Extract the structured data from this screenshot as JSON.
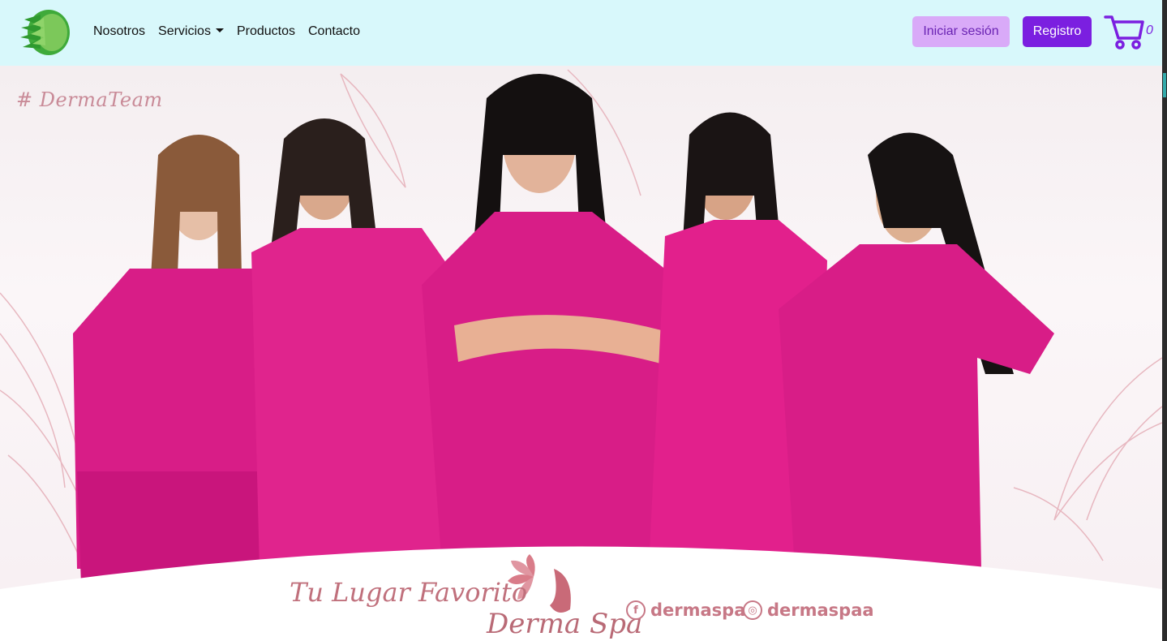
{
  "nav": {
    "links": [
      "Nosotros",
      "Servicios",
      "Productos",
      "Contacto"
    ],
    "login_label": "Iniciar sesión",
    "register_label": "Registro",
    "cart_count": "0"
  },
  "hero": {
    "hashtag": "# DermaTeam",
    "tagline": "Tu Lugar Favorito",
    "brand": "Derma Spa",
    "social": [
      "dermaspa",
      "dermaspaa"
    ]
  },
  "colors": {
    "nav_bg": "#d8f8fb",
    "login_bg": "#d9aaf8",
    "register_bg": "#7b1fe0",
    "scrub_pink": "#d81d87",
    "brand_pink": "#c77886"
  },
  "icons": [
    "leaf-logo-icon",
    "chevron-down-icon",
    "cart-icon",
    "facebook-icon",
    "instagram-icon",
    "lotus-logo-icon"
  ]
}
